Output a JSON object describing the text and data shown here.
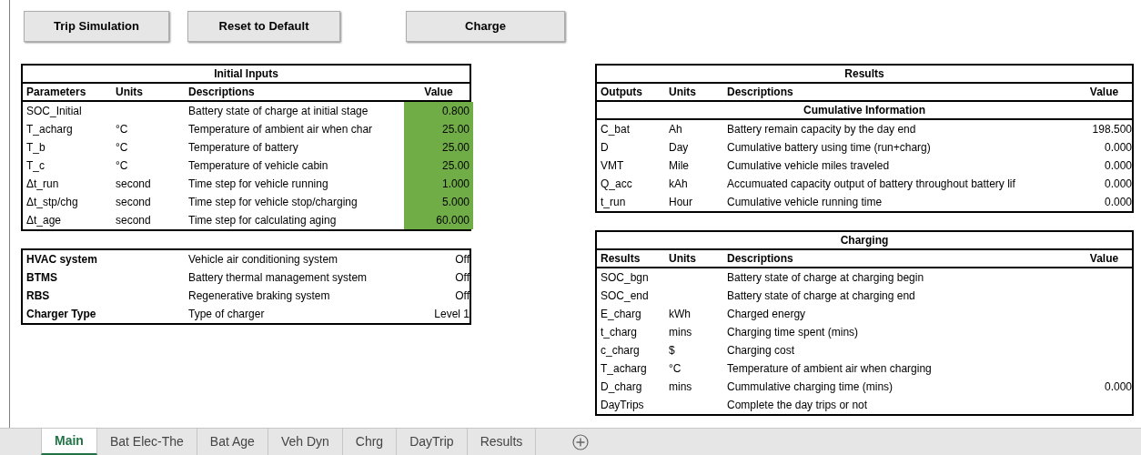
{
  "buttons": [
    "Trip Simulation",
    "Reset to Default",
    "Charge"
  ],
  "initial_inputs": {
    "title": "Initial Inputs",
    "columns": [
      "Parameters",
      "Units",
      "Descriptions",
      "Value"
    ],
    "rows": [
      {
        "parameter": "SOC_Initial",
        "units": "",
        "description": "Battery state of charge at initial stage",
        "value": "0.800",
        "highlighted": true
      },
      {
        "parameter": "T_acharg",
        "units": "°C",
        "description": "Temperature of ambient air when char",
        "value": "25.00",
        "highlighted": true
      },
      {
        "parameter": "T_b",
        "units": "°C",
        "description": "Temperature of battery",
        "value": "25.00",
        "highlighted": true
      },
      {
        "parameter": "T_c",
        "units": "°C",
        "description": "Temperature of vehicle cabin",
        "value": "25.00",
        "highlighted": true
      },
      {
        "parameter": "Δt_run",
        "units": "second",
        "description": "Time step for vehicle running",
        "value": "1.000",
        "highlighted": true
      },
      {
        "parameter": "Δt_stp/chg",
        "units": "second",
        "description": "Time step for vehicle stop/charging",
        "value": "5.000",
        "highlighted": true
      },
      {
        "parameter": "Δt_age",
        "units": "second",
        "description": "Time step for calculating aging",
        "value": "60.000",
        "highlighted": true
      }
    ]
  },
  "systems": [
    {
      "name": "HVAC system",
      "description": "Vehicle air conditioning system",
      "value": "Off"
    },
    {
      "name": "BTMS",
      "description": "Battery thermal management system",
      "value": "Off"
    },
    {
      "name": "RBS",
      "description": "Regenerative braking system",
      "value": "Off"
    },
    {
      "name": "Charger Type",
      "description": "Type of charger",
      "value": "Level 1"
    }
  ],
  "results": {
    "title": "Results",
    "columns": [
      "Outputs",
      "Units",
      "Descriptions",
      "Value"
    ],
    "section": "Cumulative Information",
    "rows": [
      {
        "output": "C_bat",
        "units": "Ah",
        "description": "Battery remain capacity by the day end",
        "value": "198.500"
      },
      {
        "output": "D",
        "units": "Day",
        "description": "Cumulative battery using time (run+charg)",
        "value": "0.000"
      },
      {
        "output": "VMT",
        "units": "Mile",
        "description": "Cumulative vehicle miles traveled",
        "value": "0.000"
      },
      {
        "output": "Q_acc",
        "units": "kAh",
        "description": "Accumuated capacity output of battery throughout battery lif",
        "value": "0.000"
      },
      {
        "output": "t_run",
        "units": "Hour",
        "description": "Cumulative vehicle running time",
        "value": "0.000"
      }
    ]
  },
  "charging": {
    "title": "Charging",
    "columns": [
      "Results",
      "Units",
      "Descriptions",
      "Value"
    ],
    "rows": [
      {
        "result": "SOC_bgn",
        "units": "",
        "description": "Battery state of charge at charging begin",
        "value": ""
      },
      {
        "result": "SOC_end",
        "units": "",
        "description": "Battery state of charge at charging end",
        "value": ""
      },
      {
        "result": "E_charg",
        "units": "kWh",
        "description": "Charged energy",
        "value": ""
      },
      {
        "result": "t_charg",
        "units": "mins",
        "description": "Charging time spent (mins)",
        "value": ""
      },
      {
        "result": "c_charg",
        "units": "$",
        "description": "Charging cost",
        "value": ""
      },
      {
        "result": "T_acharg",
        "units": "°C",
        "description": "Temperature of ambient air when charging",
        "value": ""
      },
      {
        "result": "D_charg",
        "units": "mins",
        "description": "Cummulative charging time (mins)",
        "value": "0.000"
      },
      {
        "result": "DayTrips",
        "units": "",
        "description": "Complete the day trips or not",
        "value": ""
      }
    ]
  },
  "sheet_tabs": [
    {
      "label": "Main",
      "selected": true
    },
    {
      "label": "Bat Elec-The",
      "selected": false
    },
    {
      "label": "Bat Age",
      "selected": false
    },
    {
      "label": "Veh Dyn",
      "selected": false
    },
    {
      "label": "Chrg",
      "selected": false
    },
    {
      "label": "DayTrip",
      "selected": false
    },
    {
      "label": "Results",
      "selected": false
    }
  ]
}
